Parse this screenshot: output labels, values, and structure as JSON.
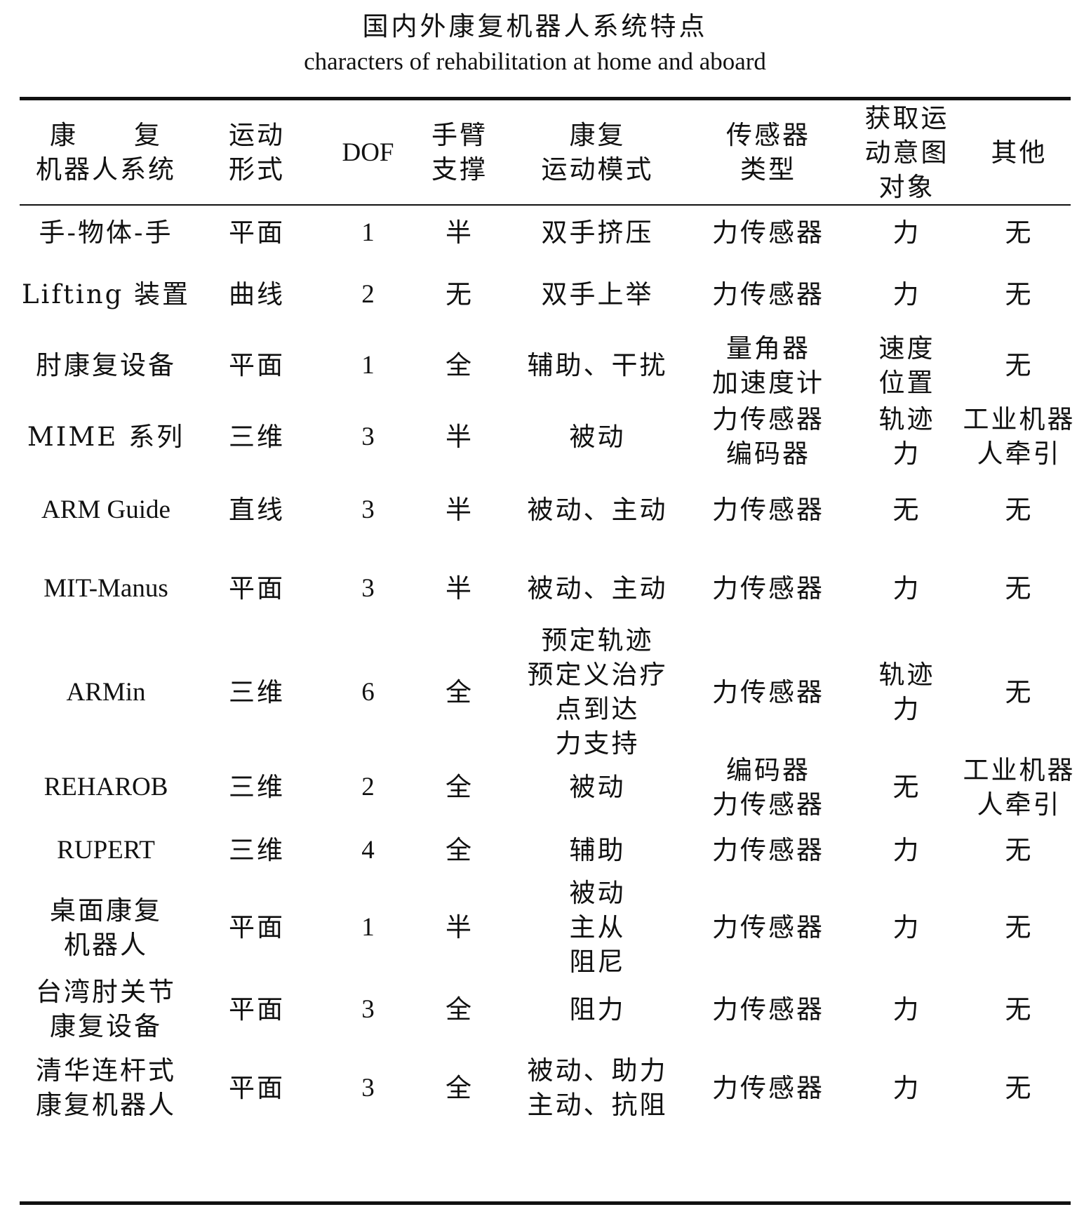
{
  "title": {
    "cn": "国内外康复机器人系统特点",
    "en": "characters of rehabilitation at home and aboard"
  },
  "table": {
    "headers": [
      [
        "康　　复",
        "机器人系统"
      ],
      [
        "运动",
        "形式"
      ],
      [
        "DOF"
      ],
      [
        "手臂",
        "支撑"
      ],
      [
        "康复",
        "运动模式"
      ],
      [
        "传感器",
        "类型"
      ],
      [
        "获取运",
        "动意图",
        "对象"
      ],
      [
        "其他"
      ]
    ],
    "rows": [
      [
        [
          "手-物体-手"
        ],
        [
          "平面"
        ],
        [
          "1"
        ],
        [
          "半"
        ],
        [
          "双手挤压"
        ],
        [
          "力传感器"
        ],
        [
          "力"
        ],
        [
          "无"
        ]
      ],
      [
        [
          "Lifting 装置"
        ],
        [
          "曲线"
        ],
        [
          "2"
        ],
        [
          "无"
        ],
        [
          "双手上举"
        ],
        [
          "力传感器"
        ],
        [
          "力"
        ],
        [
          "无"
        ]
      ],
      [
        [
          "肘康复设备"
        ],
        [
          "平面"
        ],
        [
          "1"
        ],
        [
          "全"
        ],
        [
          "辅助、干扰"
        ],
        [
          "量角器",
          "加速度计"
        ],
        [
          "速度",
          "位置"
        ],
        [
          "无"
        ]
      ],
      [
        [
          "MIME 系列"
        ],
        [
          "三维"
        ],
        [
          "3"
        ],
        [
          "半"
        ],
        [
          "被动"
        ],
        [
          "力传感器",
          "编码器"
        ],
        [
          "轨迹",
          "力"
        ],
        [
          "工业机器",
          "人牵引"
        ]
      ],
      [
        [
          "ARM Guide"
        ],
        [
          "直线"
        ],
        [
          "3"
        ],
        [
          "半"
        ],
        [
          "被动、主动"
        ],
        [
          "力传感器"
        ],
        [
          "无"
        ],
        [
          "无"
        ]
      ],
      [
        [
          "MIT-Manus"
        ],
        [
          "平面"
        ],
        [
          "3"
        ],
        [
          "半"
        ],
        [
          "被动、主动"
        ],
        [
          "力传感器"
        ],
        [
          "力"
        ],
        [
          "无"
        ]
      ],
      [
        [
          "ARMin"
        ],
        [
          "三维"
        ],
        [
          "6"
        ],
        [
          "全"
        ],
        [
          "预定轨迹",
          "预定义治疗",
          "点到达",
          "力支持"
        ],
        [
          "力传感器"
        ],
        [
          "轨迹",
          "力"
        ],
        [
          "无"
        ]
      ],
      [
        [
          "REHAROB"
        ],
        [
          "三维"
        ],
        [
          "2"
        ],
        [
          "全"
        ],
        [
          "被动"
        ],
        [
          "编码器",
          "力传感器"
        ],
        [
          "无"
        ],
        [
          "工业机器",
          "人牵引"
        ]
      ],
      [
        [
          "RUPERT"
        ],
        [
          "三维"
        ],
        [
          "4"
        ],
        [
          "全"
        ],
        [
          "辅助"
        ],
        [
          "力传感器"
        ],
        [
          "力"
        ],
        [
          "无"
        ]
      ],
      [
        [
          "桌面康复",
          "机器人"
        ],
        [
          "平面"
        ],
        [
          "1"
        ],
        [
          "半"
        ],
        [
          "被动",
          "主从",
          "阻尼"
        ],
        [
          "力传感器"
        ],
        [
          "力"
        ],
        [
          "无"
        ]
      ],
      [
        [
          "台湾肘关节",
          "康复设备"
        ],
        [
          "平面"
        ],
        [
          "3"
        ],
        [
          "全"
        ],
        [
          "阻力"
        ],
        [
          "力传感器"
        ],
        [
          "力"
        ],
        [
          "无"
        ]
      ],
      [
        [
          "清华连杆式",
          "康复机器人"
        ],
        [
          "平面"
        ],
        [
          "3"
        ],
        [
          "全"
        ],
        [
          "被动、助力",
          "主动、抗阻"
        ],
        [
          "力传感器"
        ],
        [
          "力"
        ],
        [
          "无"
        ]
      ]
    ]
  }
}
